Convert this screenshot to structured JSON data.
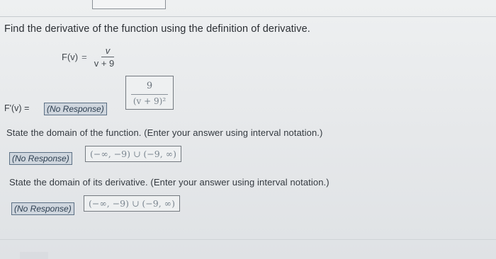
{
  "question": {
    "instruction": "Find the derivative of the function using the definition of derivative.",
    "function_name": "F(v)",
    "equals": "=",
    "numerator": "v",
    "denominator": "v + 9"
  },
  "derivative": {
    "label": "F'(v) =",
    "response_badge": "(No Response)",
    "answer_numerator": "9",
    "answer_denominator": "(v + 9)²"
  },
  "domain_function": {
    "prompt": "State the domain of the function. (Enter your answer using interval notation.)",
    "response_badge": "(No Response)",
    "answer": "(−∞, −9) ∪ (−9, ∞)"
  },
  "domain_derivative": {
    "prompt": "State the domain of its derivative. (Enter your answer using interval notation.)",
    "response_badge": "(No Response)",
    "answer": "(−∞, −9) ∪ (−9, ∞)"
  },
  "colors": {
    "badge_bg": "#cfd6de",
    "badge_border": "#5c7085",
    "answer_text": "#7c8791"
  }
}
